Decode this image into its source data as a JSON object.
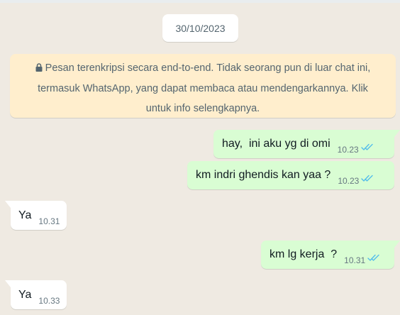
{
  "date_pill": "30/10/2023",
  "encryption_notice": {
    "line1": "Pesan terenkripsi secara end-to-end. Tidak seorang pun di luar chat ini,",
    "line2": "termasuk WhatsApp, yang dapat membaca atau mendengarkannya. Klik",
    "line3": "untuk info selengkapnya."
  },
  "messages": [
    {
      "direction": "outgoing",
      "text": "hay,  ini aku yg di omi",
      "time": "10.23",
      "status": "read"
    },
    {
      "direction": "outgoing",
      "text": "km indri ghendis kan yaa ?",
      "time": "10.23",
      "status": "read"
    },
    {
      "direction": "incoming",
      "text": "Ya",
      "time": "10.31"
    },
    {
      "direction": "outgoing",
      "text": "km lg kerja  ?",
      "time": "10.31",
      "status": "read"
    },
    {
      "direction": "incoming",
      "text": "Ya",
      "time": "10.33"
    }
  ],
  "colors": {
    "chat_background": "#efeae2",
    "outgoing_bubble": "#d9fdd3",
    "incoming_bubble": "#ffffff",
    "notice_background": "#ffeecd",
    "read_ticks": "#53bdeb"
  },
  "icons": [
    "lock-icon",
    "double-check-icon"
  ]
}
